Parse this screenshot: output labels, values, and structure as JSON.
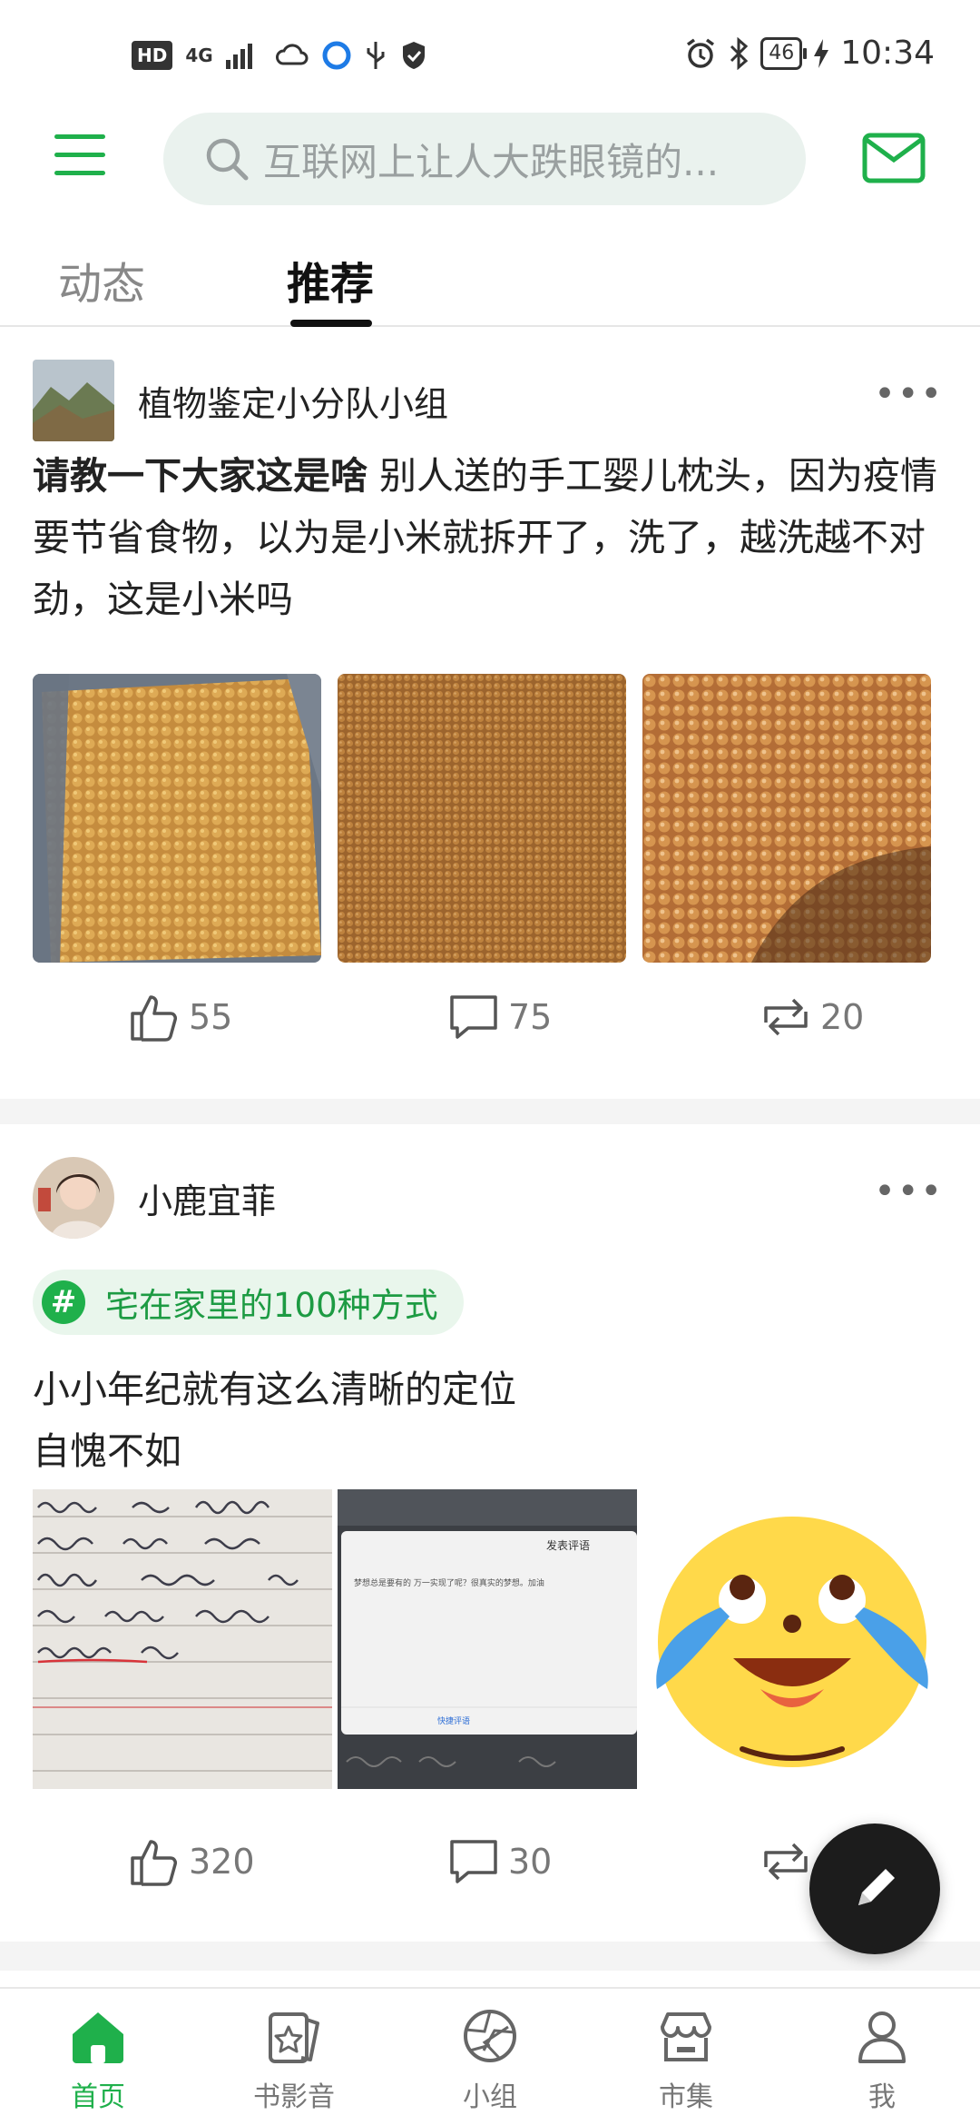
{
  "status_bar": {
    "hd": "HD",
    "network": "4G",
    "battery": "46",
    "time": "10:34"
  },
  "header": {
    "search_placeholder": "互联网上让人大跌眼镜的...",
    "menu_icon": "menu-icon",
    "mail_icon": "mail-icon"
  },
  "tabs": [
    {
      "label": "动态",
      "active": false
    },
    {
      "label": "推荐",
      "active": true
    }
  ],
  "posts": [
    {
      "author": "植物鉴定小分队小组",
      "more": "•••",
      "title": "请教一下大家这是啥",
      "body": "别人送的手工婴儿枕头，因为疫情要节省食物，以为是小米就拆开了，洗了，越洗越不对劲，这是小米吗",
      "likes": "55",
      "comments": "75",
      "reposts": "20"
    },
    {
      "author": "小鹿宜菲",
      "more": "•••",
      "topic": "宅在家里的100种方式",
      "line1": "小小年纪就有这么清晰的定位",
      "line2": "自愧不如",
      "likes": "320",
      "comments": "30",
      "reposts": ""
    }
  ],
  "image2_text": {
    "dialog_title": "发表评语",
    "dialog_body": "梦想总是要有的 万一实现了呢？很真实的梦想。加油",
    "dialog_link": "快捷评语"
  },
  "bottom_nav": [
    {
      "label": "首页",
      "icon": "home-icon",
      "active": true
    },
    {
      "label": "书影音",
      "icon": "book-movie-icon",
      "active": false
    },
    {
      "label": "小组",
      "icon": "group-icon",
      "active": false
    },
    {
      "label": "市集",
      "icon": "market-icon",
      "active": false
    },
    {
      "label": "我",
      "icon": "profile-icon",
      "active": false
    }
  ],
  "colors": {
    "accent": "#1fb04b",
    "tag_bg": "#e9f6ec",
    "search_bg": "#eaf2ee"
  }
}
